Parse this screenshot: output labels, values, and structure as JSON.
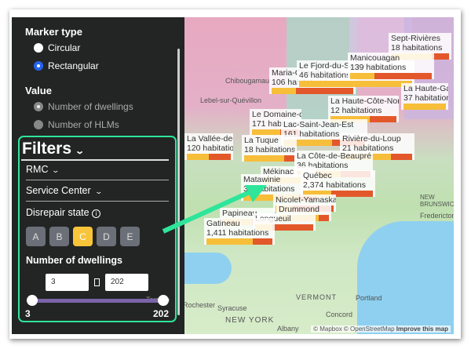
{
  "sidebar": {
    "marker_type": {
      "title": "Marker type",
      "options": [
        "Circular",
        "Rectangular"
      ],
      "selected": "Rectangular"
    },
    "value": {
      "title": "Value",
      "options": [
        "Number of dwellings",
        "Number of HLMs"
      ],
      "selected": "Number of dwellings"
    },
    "filters": {
      "title": "Filters",
      "rmc": "RMC",
      "service_center": "Service Center",
      "disrepair_title": "Disrepair state",
      "grades": [
        "A",
        "B",
        "C",
        "D",
        "E"
      ],
      "active_grade": "C",
      "dwellings_title": "Number of dwellings",
      "min_value": "3",
      "max_value": "202",
      "range_min_label": "3",
      "range_max_label": "202"
    }
  },
  "map": {
    "places": [
      "Chibougamau",
      "Lebel-sur-Quévillon",
      "VERMONT",
      "NEW YORK",
      "NEW BRUNSWICK",
      "Fredericton",
      "Portland",
      "Concord",
      "Albany",
      "Syracuse",
      "Rochester",
      "Toronto"
    ],
    "labels": [
      {
        "name": "Sept-Rivières",
        "count": "18 habitations",
        "y": 0.7,
        "o": 0.3
      },
      {
        "name": "Le Domaine-du-Roy",
        "count": "171 habitations",
        "y": 0.6,
        "o": 0.4
      },
      {
        "name": "Maria-Chapdelaine",
        "count": "106 habitations",
        "y": 0.3,
        "o": 0.7
      },
      {
        "name": "Le Fjord-du-Saguenay",
        "count": "46 habitations",
        "y": 1.0,
        "o": 0
      },
      {
        "name": "Manicouagan",
        "count": "139 habitations",
        "y": 0.3,
        "o": 0.7
      },
      {
        "name": "La Haute-Côte-Nord",
        "count": "12 habitations",
        "y": 0.6,
        "o": 0.4
      },
      {
        "name": "La Haute-Gaspésie",
        "count": "37 habitations",
        "y": 1.0,
        "o": 0
      },
      {
        "name": "Lac-Saint-Jean-Est",
        "count": "161 habitations",
        "y": 0.6,
        "o": 0.4
      },
      {
        "name": "La Vallée-de-l'Or",
        "count": "120 habitations",
        "y": 0.5,
        "o": 0.5
      },
      {
        "name": "La Tuque",
        "count": "18 habitations",
        "y": 0.8,
        "o": 0.2
      },
      {
        "name": "Rivière-du-Loup",
        "count": "21 habitations",
        "y": 0.7,
        "o": 0.3
      },
      {
        "name": "La Côte-de-Beaupré",
        "count": "36 habitations",
        "y": 0.6,
        "o": 0.4
      },
      {
        "name": "Mékinac",
        "count": "",
        "y": 0.8,
        "o": 0.2
      },
      {
        "name": "Matawinie",
        "count": "39 habitations",
        "y": 0.75,
        "o": 0.25
      },
      {
        "name": "Québec",
        "count": "2,374 habitations",
        "y": 0.4,
        "o": 0.6
      },
      {
        "name": "Nicolet-Yamaska",
        "count": "",
        "y": 0.3,
        "o": 0.7
      },
      {
        "name": "Drummond",
        "count": "",
        "y": 0.8,
        "o": 0.2
      },
      {
        "name": "Papineau",
        "count": "",
        "y": 0.6,
        "o": 0.4
      },
      {
        "name": "Longueuil",
        "count": "",
        "y": 0.3,
        "o": 0.7
      },
      {
        "name": "Gatineau",
        "count": "1,411 habitations",
        "y": 0.7,
        "o": 0.3
      }
    ],
    "attribution": {
      "mapbox": "© Mapbox",
      "osm": "© OpenStreetMap",
      "improve": "Improve this map"
    }
  },
  "colors": {
    "accent": "#2ee59a",
    "good": "#f7be3a",
    "bad": "#e3582a",
    "active_grade": "#f8c43a"
  }
}
